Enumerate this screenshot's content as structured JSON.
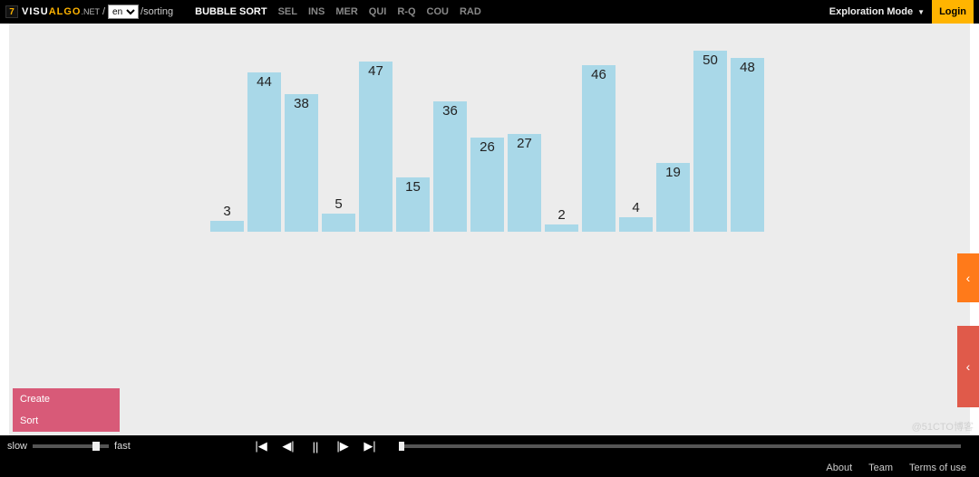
{
  "header": {
    "badge": "7",
    "logo_visu": "VISU",
    "logo_algo": "ALGO",
    "logo_suffix": ".NET",
    "slash": "/",
    "lang": "en",
    "path": "/sorting",
    "tabs": [
      {
        "label": "BUBBLE SORT",
        "active": true
      },
      {
        "label": "SEL",
        "active": false
      },
      {
        "label": "INS",
        "active": false
      },
      {
        "label": "MER",
        "active": false
      },
      {
        "label": "QUI",
        "active": false
      },
      {
        "label": "R-Q",
        "active": false
      },
      {
        "label": "COU",
        "active": false
      },
      {
        "label": "RAD",
        "active": false
      }
    ],
    "mode_label": "Exploration Mode",
    "login": "Login"
  },
  "chart_data": {
    "type": "bar",
    "title": "",
    "xlabel": "",
    "ylabel": "",
    "ylim": [
      0,
      50
    ],
    "categories": [
      "3",
      "44",
      "38",
      "5",
      "47",
      "15",
      "36",
      "26",
      "27",
      "2",
      "46",
      "4",
      "19",
      "50",
      "48"
    ],
    "values": [
      3,
      44,
      38,
      5,
      47,
      15,
      36,
      26,
      27,
      2,
      46,
      4,
      19,
      50,
      48
    ],
    "bar_color": "#a9d8e8"
  },
  "actions": {
    "items": [
      "Create",
      "Sort"
    ]
  },
  "side_tabs": {
    "orange_icon": "‹",
    "red_icon": "‹"
  },
  "playback": {
    "slow_label": "slow",
    "fast_label": "fast",
    "speed_position_pct": 78,
    "icons": {
      "first": "|◀",
      "prev": "◀|",
      "pause": "||",
      "next": "|▶",
      "last": "▶|"
    },
    "progress_pct": 0
  },
  "footer": {
    "links": [
      "About",
      "Team",
      "Terms of use"
    ]
  },
  "watermark": "@51CTO博客"
}
